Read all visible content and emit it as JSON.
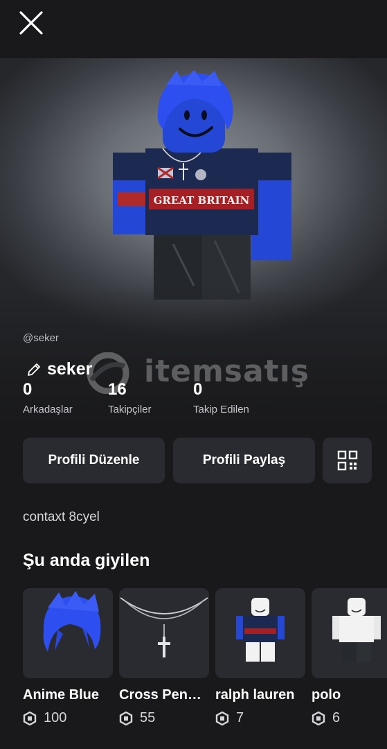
{
  "header": {
    "close_icon": "close-icon"
  },
  "profile": {
    "display_name": "seker",
    "handle": "@seker",
    "edit_icon": "pencil-icon",
    "watermark": "itemsatış",
    "stats": [
      {
        "value": "0",
        "label": "Arkadaşlar"
      },
      {
        "value": "16",
        "label": "Takipçiler"
      },
      {
        "value": "0",
        "label": "Takip Edilen"
      }
    ]
  },
  "actions": {
    "edit_label": "Profili Düzenle",
    "share_label": "Profili Paylaş",
    "qr_icon": "qr-code-icon"
  },
  "bio": "contaxt 8cyel",
  "wearing": {
    "title": "Şu anda giyilen",
    "items": [
      {
        "name": "Anime Blue",
        "price": "100"
      },
      {
        "name": "Cross Pen…",
        "price": "55"
      },
      {
        "name": "ralph lauren",
        "price": "7"
      },
      {
        "name": "polo",
        "price": "6"
      }
    ]
  },
  "colors": {
    "background": "#19191b",
    "card": "#2a2b30",
    "hair_blue": "#2747e0",
    "shirt_navy": "#1c2a52"
  }
}
